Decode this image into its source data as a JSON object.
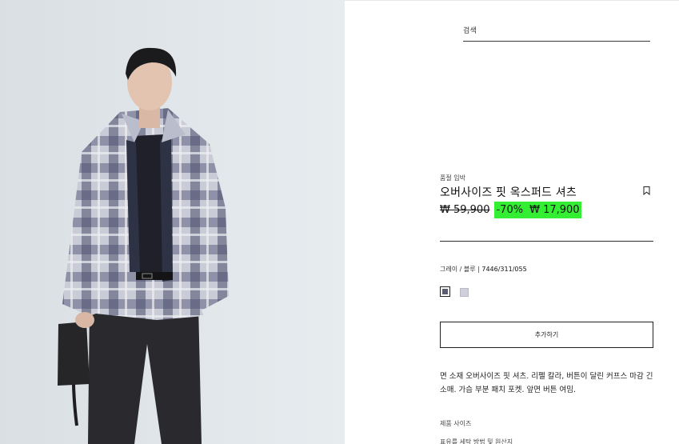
{
  "search": {
    "label": "검색"
  },
  "product": {
    "tag": "품절 임박",
    "name": "오버사이즈 핏 옥스퍼드 셔츠",
    "price": {
      "original": "₩ 59,900",
      "discount": "-70%",
      "sale": "₩ 17,900",
      "highlight_color": "#33ee33"
    },
    "color_label": "그레이 / 블루 | ",
    "color_code": "7446/311/055",
    "swatches": [
      {
        "name": "gray-blue",
        "color": "#5b5e73",
        "selected": true
      },
      {
        "name": "light-lilac",
        "color": "#cfd0dc",
        "selected": false
      }
    ],
    "add_button_label": "추가하기",
    "description": "면 소재 오버사이즈 핏 셔츠. 리펠 칼라, 버튼이 달린 커프스 마감 긴소매. 가슴 부분 패치 포켓. 앞면 버튼 여밈.",
    "size_section_title": "제품 사이즈",
    "size_detail": "표유를  세탁 방법 및 원산지"
  },
  "icons": {
    "bookmark": "bookmark-icon"
  }
}
